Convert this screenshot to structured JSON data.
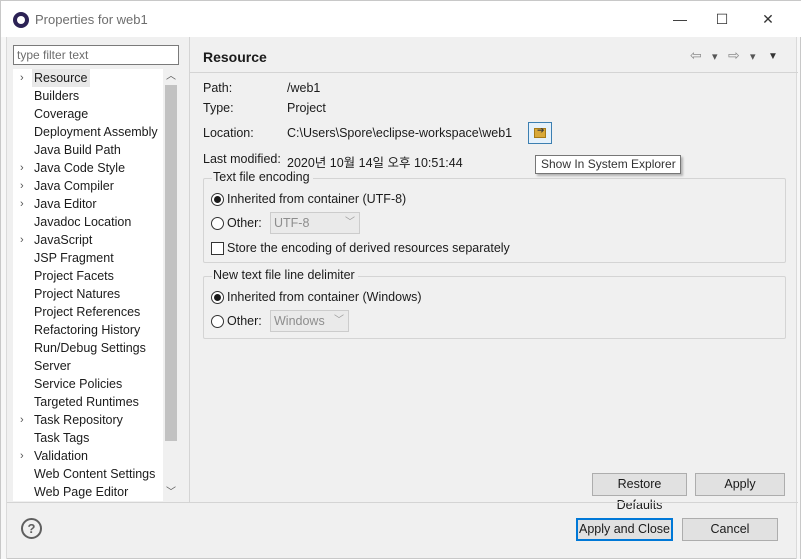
{
  "window": {
    "title": "Properties for web1",
    "controls": {
      "minimize": "—",
      "maximize": "☐",
      "close": "✕"
    }
  },
  "filter": {
    "placeholder": "type filter text",
    "value": ""
  },
  "tree": {
    "selected": "Resource",
    "items": [
      {
        "label": "Resource",
        "expandable": true
      },
      {
        "label": "Builders",
        "expandable": false
      },
      {
        "label": "Coverage",
        "expandable": false
      },
      {
        "label": "Deployment Assembly",
        "expandable": false
      },
      {
        "label": "Java Build Path",
        "expandable": false
      },
      {
        "label": "Java Code Style",
        "expandable": true
      },
      {
        "label": "Java Compiler",
        "expandable": true
      },
      {
        "label": "Java Editor",
        "expandable": true
      },
      {
        "label": "Javadoc Location",
        "expandable": false
      },
      {
        "label": "JavaScript",
        "expandable": true
      },
      {
        "label": "JSP Fragment",
        "expandable": false
      },
      {
        "label": "Project Facets",
        "expandable": false
      },
      {
        "label": "Project Natures",
        "expandable": false
      },
      {
        "label": "Project References",
        "expandable": false
      },
      {
        "label": "Refactoring History",
        "expandable": false
      },
      {
        "label": "Run/Debug Settings",
        "expandable": false
      },
      {
        "label": "Server",
        "expandable": false
      },
      {
        "label": "Service Policies",
        "expandable": false
      },
      {
        "label": "Targeted Runtimes",
        "expandable": false
      },
      {
        "label": "Task Repository",
        "expandable": true
      },
      {
        "label": "Task Tags",
        "expandable": false
      },
      {
        "label": "Validation",
        "expandable": true
      },
      {
        "label": "Web Content Settings",
        "expandable": false
      },
      {
        "label": "Web Page Editor",
        "expandable": false
      }
    ]
  },
  "page": {
    "title": "Resource",
    "nav": {
      "back": "⇦",
      "back_menu": "▾",
      "forward": "⇨",
      "forward_menu": "▾",
      "view_menu": "▼"
    },
    "info": {
      "path_label": "Path:",
      "path_value": "/web1",
      "type_label": "Type:",
      "type_value": "Project",
      "location_label": "Location:",
      "location_value": "C:\\Users\\Spore\\eclipse-workspace\\web1",
      "modified_label": "Last modified:",
      "modified_value": "2020년 10월 14일 오후 10:51:44"
    },
    "tooltip": "Show In System Explorer",
    "encoding": {
      "title": "Text file encoding",
      "inherited_label": "Inherited from container (UTF-8)",
      "inherited_selected": true,
      "other_label": "Other:",
      "other_value": "UTF-8",
      "store_label": "Store the encoding of derived resources separately",
      "store_checked": false
    },
    "delimiter": {
      "title": "New text file line delimiter",
      "inherited_label": "Inherited from container (Windows)",
      "inherited_selected": true,
      "other_label": "Other:",
      "other_value": "Windows"
    },
    "buttons": {
      "restore_defaults": "Restore Defaults",
      "apply": "Apply"
    }
  },
  "footer": {
    "help": "?",
    "apply_and_close": "Apply and Close",
    "cancel": "Cancel"
  },
  "colors": {
    "accent": "#0078d7",
    "window_bg": "#f0f0f0",
    "selection": "#e8e8e8"
  }
}
